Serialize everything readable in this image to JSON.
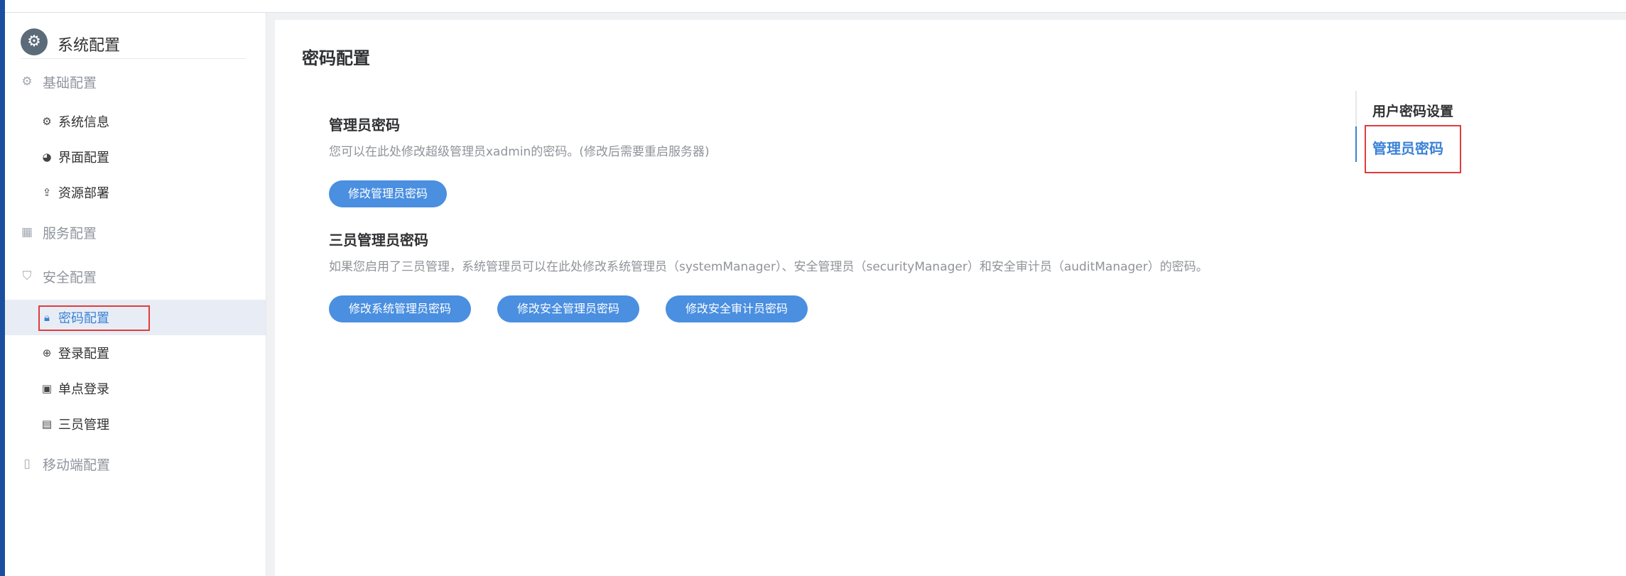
{
  "sidebar": {
    "title": "系统配置",
    "groups": {
      "basic": "基础配置",
      "service": "服务配置",
      "security": "安全配置",
      "mobile": "移动端配置"
    },
    "items": {
      "system_info": "系统信息",
      "ui_config": "界面配置",
      "resource_deploy": "资源部署",
      "password_config": "密码配置",
      "login_config": "登录配置",
      "sso": "单点登录",
      "three_admin": "三员管理"
    }
  },
  "main": {
    "title": "密码配置",
    "admin_section": {
      "title": "管理员密码",
      "desc": "您可以在此处修改超级管理员xadmin的密码。(修改后需要重启服务器)",
      "button": "修改管理员密码"
    },
    "three_section": {
      "title": "三员管理员密码",
      "desc": "如果您启用了三员管理，系统管理员可以在此处修改系统管理员（systemManager）、安全管理员（securityManager）和安全审计员（auditManager）的密码。",
      "buttons": [
        "修改系统管理员密码",
        "修改安全管理员密码",
        "修改安全审计员密码"
      ]
    }
  },
  "anchor": {
    "title": "用户密码设置",
    "link": "管理员密码"
  },
  "colors": {
    "accent": "#3b82d6",
    "button": "#4a8fe0",
    "highlight_box": "#e03c3c"
  }
}
